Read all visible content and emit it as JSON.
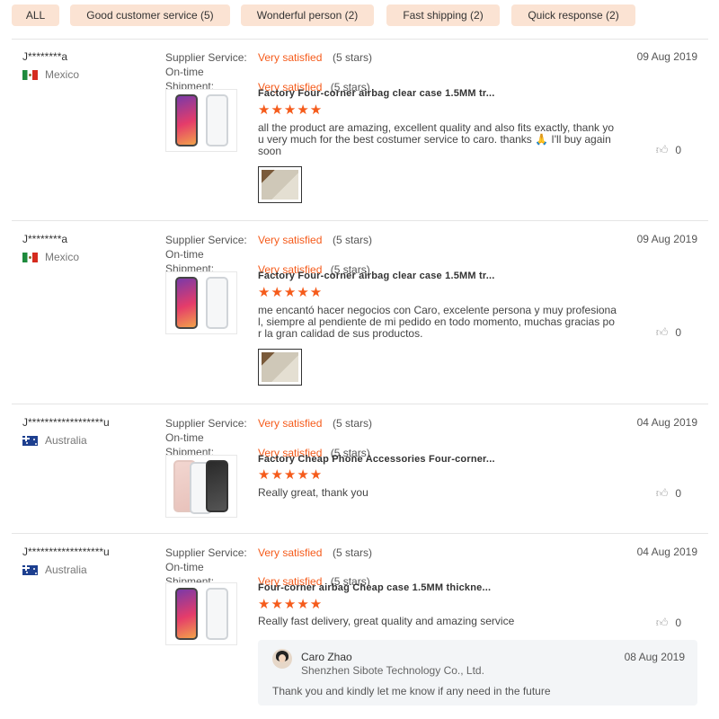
{
  "filters": [
    {
      "label": "ALL"
    },
    {
      "label": "Good customer service (5)"
    },
    {
      "label": "Wonderful person (2)"
    },
    {
      "label": "Fast shipping (2)"
    },
    {
      "label": "Quick response (2)"
    }
  ],
  "labels": {
    "supplier_service": "Supplier Service:",
    "on_time": "On-time",
    "shipment": "Shipment:"
  },
  "colors": {
    "accent": "#f55b1b",
    "chip": "#fbe3d3"
  },
  "reviews": [
    {
      "user": "J********a",
      "country": "Mexico",
      "flag": "mexico-flag-icon",
      "service_rating": "Very satisfied",
      "service_stars": "(5 stars)",
      "shipment_rating": "Very satisfied",
      "shipment_stars": "(5 stars)",
      "date": "09 Aug 2019",
      "product_title": "Factory Four-corner airbag clear case 1.5MM tr...",
      "stars": "★★★★★",
      "rating": 5,
      "comment": "all the  product are amazing, excellent quality and also fits exactly, thank you very much for the best costumer service to caro. thanks 🙏 I'll buy again soon",
      "likes": "0"
    },
    {
      "user": "J********a",
      "country": "Mexico",
      "flag": "mexico-flag-icon",
      "service_rating": "Very satisfied",
      "service_stars": "(5 stars)",
      "shipment_rating": "Very satisfied",
      "shipment_stars": "(5 stars)",
      "date": "09 Aug 2019",
      "product_title": "Factory Four-corner airbag clear case 1.5MM tr...",
      "stars": "★★★★★",
      "rating": 5,
      "comment": "me encantó hacer negocios con Caro, excelente persona y muy profesional, siempre al pendiente de mi pedido en todo momento, muchas gracias por la gran calidad de sus productos.",
      "likes": "0"
    },
    {
      "user": "J******************u",
      "country": "Australia",
      "flag": "australia-flag-icon",
      "service_rating": "Very satisfied",
      "service_stars": "(5 stars)",
      "shipment_rating": "Very satisfied",
      "shipment_stars": "(5 stars)",
      "date": "04 Aug 2019",
      "product_title": "Factory Cheap Phone Accessories Four-corner...",
      "stars": "★★★★★",
      "rating": 5,
      "comment": "Really great, thank you",
      "likes": "0"
    },
    {
      "user": "J******************u",
      "country": "Australia",
      "flag": "australia-flag-icon",
      "service_rating": "Very satisfied",
      "service_stars": "(5 stars)",
      "shipment_rating": "Very satisfied",
      "shipment_stars": "(5 stars)",
      "date": "04 Aug 2019",
      "product_title": "Four-corner airbag Cheap case 1.5MM thickne...",
      "stars": "★★★★★",
      "rating": 5,
      "comment": "Really fast delivery, great quality and amazing service",
      "likes": "0",
      "reply": {
        "name": "Caro Zhao",
        "company": "Shenzhen Sibote Technology Co., Ltd.",
        "date": "08 Aug 2019",
        "text": "Thank you and kindly let me know if any need in the future"
      }
    }
  ]
}
